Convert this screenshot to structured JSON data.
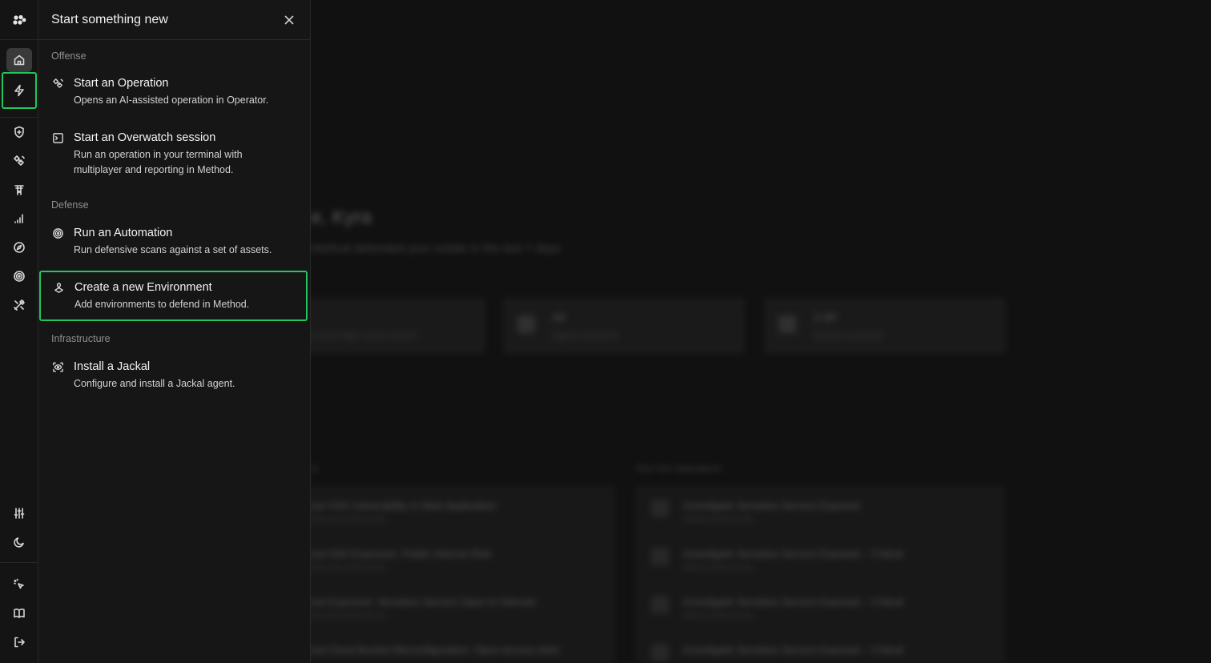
{
  "panel": {
    "title": "Start something new",
    "sections": [
      {
        "label": "Offense",
        "items": [
          {
            "title": "Start an Operation",
            "desc": "Opens an AI-assisted operation in Operator."
          },
          {
            "title": "Start an Overwatch session",
            "desc": "Run an operation in your terminal with multiplayer and reporting in Method."
          }
        ]
      },
      {
        "label": "Defense",
        "items": [
          {
            "title": "Run an Automation",
            "desc": "Run defensive scans against a set of assets."
          },
          {
            "title": "Create a new Environment",
            "desc": "Add environments to defend in Method."
          }
        ]
      },
      {
        "label": "Infrastructure",
        "items": [
          {
            "title": "Install a Jackal",
            "desc": "Configure and install a Jackal agent."
          }
        ]
      }
    ]
  },
  "rail": {
    "icons": [
      "logo-icon",
      "home-icon",
      "lightning-icon",
      "shield-icon",
      "satellite-icon",
      "tower-icon",
      "signal-icon",
      "compass-icon",
      "radar-icon",
      "tools-icon",
      "sliders-icon",
      "moon-icon",
      "sparkle-cursor-icon",
      "book-icon",
      "logout-icon"
    ]
  },
  "background": {
    "greeting": "e, Kyra",
    "subtitle": "Method defended your estate in the last 7 days",
    "cards": [
      {
        "num": "",
        "label": "ical and High Issues found"
      },
      {
        "num": "44",
        "label": "Agent sessions"
      },
      {
        "num": "2.4K",
        "label": "Assets scanned"
      }
    ],
    "left_heading": "ts",
    "right_heading": "Your live Operations",
    "left_rows": [
      {
        "title": "ical XSS Vulnerability in Web Application",
        "sub": "Detected 2026-04-08"
      },
      {
        "title": "ical SSH Exposure: Public Internet Risk",
        "sub": "Detected 2026-04-08"
      },
      {
        "title": "ical Exposure: Sensitive Service Open to Internet",
        "sub": "Detected 2026-04-08"
      },
      {
        "title": "ical Cloud Bucket Misconfiguration: Open Access Alert",
        "sub": ""
      }
    ],
    "right_rows": [
      {
        "title": "Investigate Sensitive Service Exposed",
        "sub": "Started 2026-04-08"
      },
      {
        "title": "Investigate Sensitive Service Exposed – Critical",
        "sub": "Started 2026-04-08"
      },
      {
        "title": "Investigate Sensitive Service Exposed – Critical",
        "sub": "Started 2026-04-08"
      },
      {
        "title": "Investigate Sensitive Service Exposed – Critical",
        "sub": ""
      }
    ]
  },
  "colors": {
    "highlight": "#22c55e",
    "panel_bg": "#161616",
    "rail_bg": "#141414"
  }
}
